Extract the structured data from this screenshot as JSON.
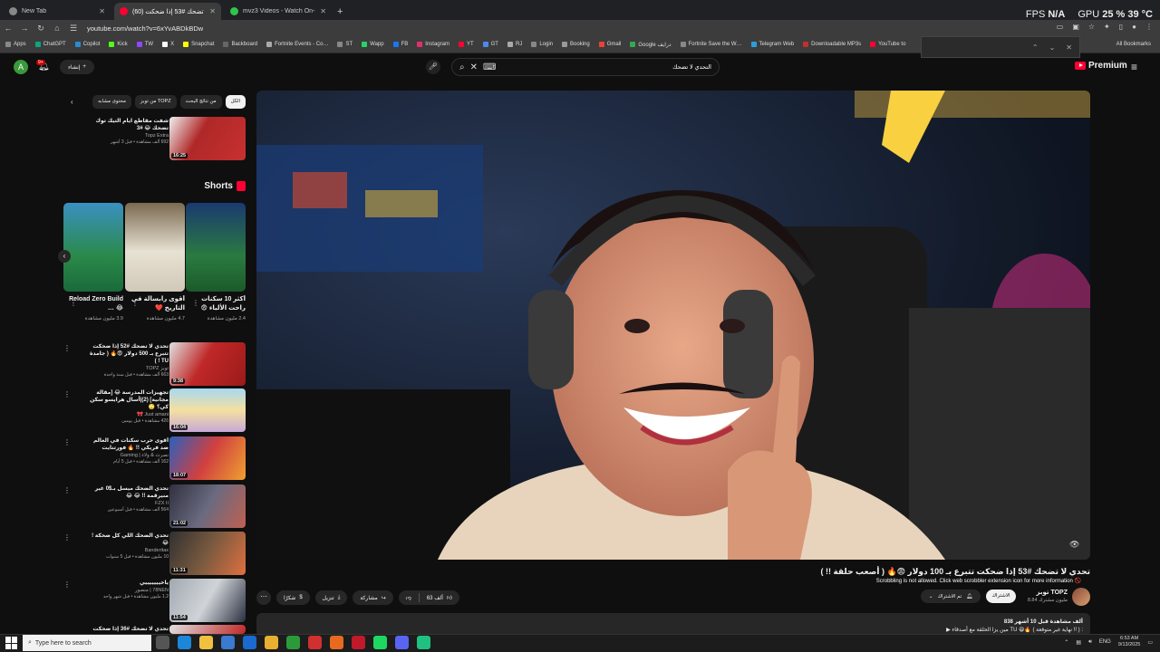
{
  "browser": {
    "tabs": [
      {
        "title": "New Tab",
        "active": false
      },
      {
        "title": "تحدي لا تضحك #53 إذا ضحكت (60)",
        "active": true
      },
      {
        "title": "mvz3 Videos - Watch On-Dema…",
        "active": false
      }
    ],
    "url": "youtube.com/watch?v=6xYvABDkBDw",
    "bookmarks": [
      "Apps",
      "ChatGPT",
      "Copilot",
      "Kick",
      "TW",
      "X",
      "Snapchat",
      "Backboard",
      "Fortnite Events - Co…",
      "ST",
      "Wapp",
      "FB",
      "Instagram",
      "YT",
      "GT",
      "RJ",
      "Login",
      "Booking",
      "Gmail",
      "Google درايف",
      "Fortnite Save the W…",
      "Telegram Web",
      "Downloadable MP3s",
      "YouTube to"
    ],
    "all_bookmarks": "All Bookmarks"
  },
  "hud": {
    "fps_label": "FPS",
    "fps_value": "N/A",
    "gpu_label": "GPU",
    "gpu_value": "25 %",
    "gpu_temp": "39 °C"
  },
  "header": {
    "avatar_letter": "A",
    "notif_count": "9+",
    "create_label": "إنشاء",
    "search_query": "التحدي لا تضحك",
    "logo_text": "Premium",
    "logo_country": "SA"
  },
  "chips": [
    "الكل",
    "من نتائج البحث",
    "من توبز TOPZ",
    "محتوى مشابه"
  ],
  "sidebar_top": {
    "title": "شفت مقاطع ايام التيك توك تضحك 😂 #3",
    "channel": "Topz Extra",
    "views": "692 ألف مشاهدة • قبل 3 أشهر",
    "duration": "16:25"
  },
  "shorts": {
    "heading": "Shorts",
    "items": [
      {
        "title": "أكثر 10 سكنات راحت الألياء 😨",
        "views": "2.4 مليون مشاهدة"
      },
      {
        "title": "أقوى رابسالة في التاريخ ❤️",
        "views": "4.7 مليون مشاهدة"
      },
      {
        "title": "Reload Zero Build 😂 …",
        "views": "3.9 مليون مشاهدة"
      }
    ]
  },
  "sidebar": [
    {
      "title": "تحدي لا تضحك #52 إذا ضحكت تتبرع بـ 500 دولار 😨🔥 ( جامدة TU ! )",
      "channel": "توبز TOPZ",
      "views": "663 ألف مشاهدة • قبل سنة واحدة",
      "duration": "9:38"
    },
    {
      "title": "تجهيزات المدرسة 😂 [مقالة مجانية] (2)|أسال هرايسو سكن كي؟ 🙄",
      "channel": "Just amani 🎀",
      "views": "426 مشاهدة • قبل يومين",
      "duration": "16:04"
    },
    {
      "title": "أقوى حرب سكنات في العالم ضد فريكي !! 🔥 فورتنايت",
      "channel": "نصرت & ولاء | Gaming",
      "views": "162 ألف مشاهدة • قبل 5 أيام",
      "duration": "18:07"
    },
    {
      "title": "تحدي الضحك ميسل بـ$0 غير منيرقمة !! 😂 😂",
      "channel": "FZX II",
      "views": "564 ألف مشاهدة • قبل أسبوعين",
      "duration": "21:02"
    },
    {
      "title": "تحدي الضحك اللي كل ضحكة ! 😂",
      "channel": "Banderitax",
      "views": "10 مليون مشاهدة • قبل 5 سنوات",
      "duration": "11:31"
    },
    {
      "title": "ياخيييييييي",
      "channel": "78NEN | منصور",
      "views": "1.2 مليون مشاهدة • قبل شهر واحد",
      "duration": "11:54"
    },
    {
      "title": "تحدي لا تضحك #36 إذا ضحكت تتبرع",
      "channel": "",
      "views": "",
      "duration": ""
    }
  ],
  "video": {
    "title": "تحدي لا تضحك #53 إذا ضحكت تتبرع بـ 100 دولار 😨🔥 ( أصعب حلقة !! )",
    "scrubbing": "Scrobbling is not allowed. Click web scrobbler extension icon for more information 🚫",
    "likes": "63 ألف",
    "share": "مشاركة",
    "download": "تنزيل",
    "clip": "شكرًا",
    "channel_name": "توبز TOPZ",
    "subscribers": "8.84 مليون مشترك",
    "subscribed_label": "الاشتراك",
    "notif_label": "تم الاشتراك",
    "desc_views": "838 ألف مشاهدة قبل 10 أشهر",
    "desc_text": "▶ مين يزا الحلقة مع أصدقاء TU 😆🔥 ( نهاية غير متوقعة !! ) :"
  },
  "taskbar": {
    "search_placeholder": "Type here to search",
    "lang": "ENG",
    "time": "6:53 AM",
    "date": "9/13/2025"
  }
}
